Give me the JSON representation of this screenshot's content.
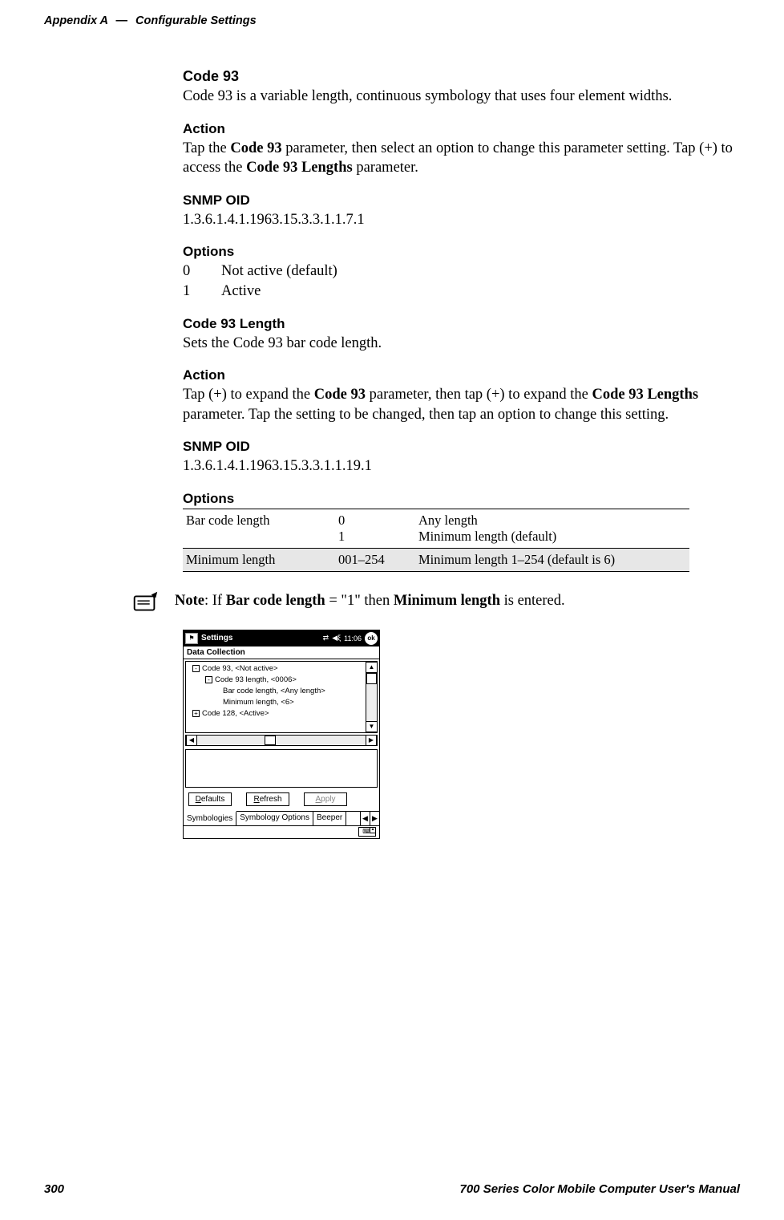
{
  "header": {
    "left1": "Appendix A",
    "sep": "—",
    "left2": "Configurable Settings"
  },
  "s1": {
    "title": "Code 93",
    "body": "Code 93 is a variable length, continuous symbology that uses four element widths."
  },
  "s2": {
    "title": "Action",
    "pre": "Tap the ",
    "b1": "Code 93",
    "mid": " parameter, then select an option to change this parameter setting. Tap (+) to access the ",
    "b2": "Code 93 Lengths",
    "post": " parameter."
  },
  "s3": {
    "title": "SNMP OID",
    "body": "1.3.6.1.4.1.1963.15.3.3.1.1.7.1"
  },
  "s4": {
    "title": "Options",
    "row1k": "0",
    "row1v": "Not active (default)",
    "row2k": "1",
    "row2v": "Active"
  },
  "s5": {
    "title": "Code 93 Length",
    "body": "Sets the Code 93 bar code length."
  },
  "s6": {
    "title": "Action",
    "pre": "Tap (+) to expand the ",
    "b1": "Code 93",
    "mid1": " parameter, then tap (+) to expand the ",
    "b2": "Code 93 Lengths",
    "mid2": " parameter. Tap the setting to be changed, then tap an option to change this setting."
  },
  "s7": {
    "title": "SNMP OID",
    "body": "1.3.6.1.4.1.1963.15.3.3.1.1.19.1"
  },
  "s8": {
    "title": "Options",
    "r1c1": "Bar code length",
    "r1c2a": "0",
    "r1c3a": "Any length",
    "r1c2b": "1",
    "r1c3b": "Minimum length (default)",
    "r2c1": "Minimum length",
    "r2c2": "001–254",
    "r2c3": "Minimum length 1–254 (default is 6)"
  },
  "note": {
    "b1": "Note",
    "t1": ": If ",
    "b2": "Bar code length",
    "t2": " = \"1\" then ",
    "b3": "Minimum length",
    "t3": " is entered."
  },
  "shot": {
    "tb_title": "Settings",
    "tb_time": "11:06",
    "tb_ok": "ok",
    "subtitle": "Data Collection",
    "tree": {
      "l1": "Code 93, <Not active>",
      "l2": "Code 93 length, <0006>",
      "l3": "Bar code length, <Any length>",
      "l4": "Minimum length, <6>",
      "l5": "Code 128, <Active>"
    },
    "btn_defaults_u": "D",
    "btn_defaults_rest": "efaults",
    "btn_refresh_u": "R",
    "btn_refresh_rest": "efresh",
    "btn_apply_u": "A",
    "btn_apply_rest": "pply",
    "tab1": "Symbologies",
    "tab2": "Symbology Options",
    "tab3": "Beeper",
    "sip": "⌨"
  },
  "footer": {
    "pagenum": "300",
    "title": "700 Series Color Mobile Computer User's Manual"
  }
}
